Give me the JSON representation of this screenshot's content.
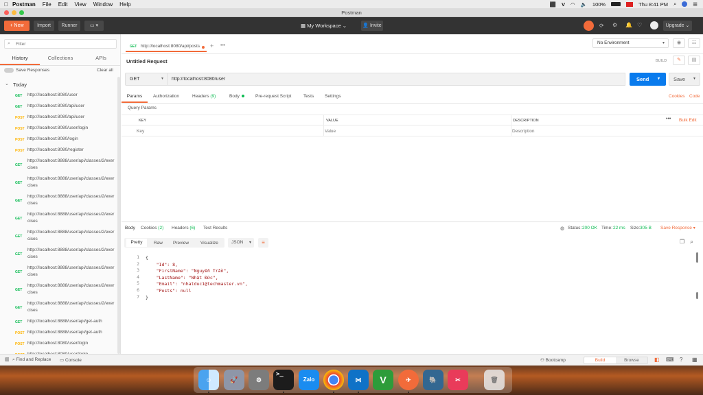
{
  "menubar": {
    "app": "Postman",
    "items": [
      "File",
      "Edit",
      "View",
      "Window",
      "Help"
    ],
    "battery": "100%",
    "clock": "Thu 8:41 PM"
  },
  "window": {
    "title": "Postman"
  },
  "toolbar": {
    "new_label": "New",
    "import_label": "Import",
    "runner_label": "Runner",
    "workspace_label": "My Workspace",
    "invite_label": "Invite",
    "upgrade_label": "Upgrade"
  },
  "sidebar": {
    "filter_placeholder": "Filter",
    "tabs": [
      "History",
      "Collections",
      "APIs"
    ],
    "save_responses": "Save Responses",
    "clear_all": "Clear all",
    "group": "Today",
    "items": [
      {
        "method": "GET",
        "url": "http://localhost:8080/user"
      },
      {
        "method": "GET",
        "url": "http://localhost:8080/api/user"
      },
      {
        "method": "POST",
        "url": "http://localhost:8080/api/user"
      },
      {
        "method": "POST",
        "url": "http://localhost:8080/user/login"
      },
      {
        "method": "POST",
        "url": "http://localhost:8080/login"
      },
      {
        "method": "POST",
        "url": "http://localhost:8080/register"
      },
      {
        "method": "GET",
        "url": "http://localhost:8888/user/api/classes/2/exercises"
      },
      {
        "method": "GET",
        "url": "http://localhost:8888/user/api/classes/2/exercises"
      },
      {
        "method": "GET",
        "url": "http://localhost:8888/user/api/classes/2/exercises"
      },
      {
        "method": "GET",
        "url": "http://localhost:8888/user/api/classes/2/exercises"
      },
      {
        "method": "GET",
        "url": "http://localhost:8888/user/api/classes/2/exercises"
      },
      {
        "method": "GET",
        "url": "http://localhost:8888/user/api/classes/2/exercises"
      },
      {
        "method": "GET",
        "url": "http://localhost:8888/user/api/classes/2/exercises"
      },
      {
        "method": "GET",
        "url": "http://localhost:8888/user/api/classes/2/exercises"
      },
      {
        "method": "GET",
        "url": "http://localhost:8888/user/api/classes/2/exercises"
      },
      {
        "method": "GET",
        "url": "http://localhost:8888/user/api/get-auth"
      },
      {
        "method": "POST",
        "url": "http://localhost:8888/user/api/get-auth"
      },
      {
        "method": "POST",
        "url": "http://localhost:8080/user/login"
      },
      {
        "method": "POST",
        "url": "http://localhost:8080/user/login"
      }
    ]
  },
  "request_tab": {
    "method": "GET",
    "url": "http://localhost:8080/api/posts"
  },
  "environment": "No Environment",
  "request": {
    "name": "Untitled Request",
    "build_label": "BUILD",
    "method": "GET",
    "url": "http://localhost:8080/user",
    "send_label": "Send",
    "save_label": "Save",
    "tabs": [
      "Params",
      "Authorization",
      "Headers",
      "(9)",
      "Body",
      "Pre-request Script",
      "Tests",
      "Settings"
    ],
    "cookies_link": "Cookies",
    "code_link": "Code",
    "query_params_title": "Query Params",
    "columns": [
      "KEY",
      "VALUE",
      "DESCRIPTION"
    ],
    "bulk_edit": "Bulk Edit",
    "key_placeholder": "Key",
    "value_placeholder": "Value",
    "description_placeholder": "Description"
  },
  "response": {
    "tabs": [
      "Body",
      "Cookies",
      "(2)",
      "Headers",
      "(6)",
      "Test Results"
    ],
    "status_label": "Status:",
    "status_value": "200 OK",
    "time_label": "Time:",
    "time_value": "22 ms",
    "size_label": "Size:",
    "size_value": "305 B",
    "save_response": "Save Response",
    "view_modes": [
      "Pretty",
      "Raw",
      "Preview",
      "Visualize"
    ],
    "format": "JSON",
    "line_numbers": [
      "1",
      "2",
      "3",
      "4",
      "5",
      "6",
      "7"
    ],
    "lines": [
      "{",
      "    \"Id\": 8,",
      "    \"FirstName\": \"Nguyễn Trần\",",
      "    \"LastName\": \"Nhật Đức\",",
      "    \"Email\": \"nhatduc1@techmaster.vn\",",
      "    \"Posts\": null",
      "}"
    ]
  },
  "footer": {
    "find_replace": "Find and Replace",
    "console": "Console",
    "bootcamp": "Bootcamp",
    "build": "Build",
    "browse": "Browse"
  },
  "dock": {
    "zalo": "Zalo"
  }
}
